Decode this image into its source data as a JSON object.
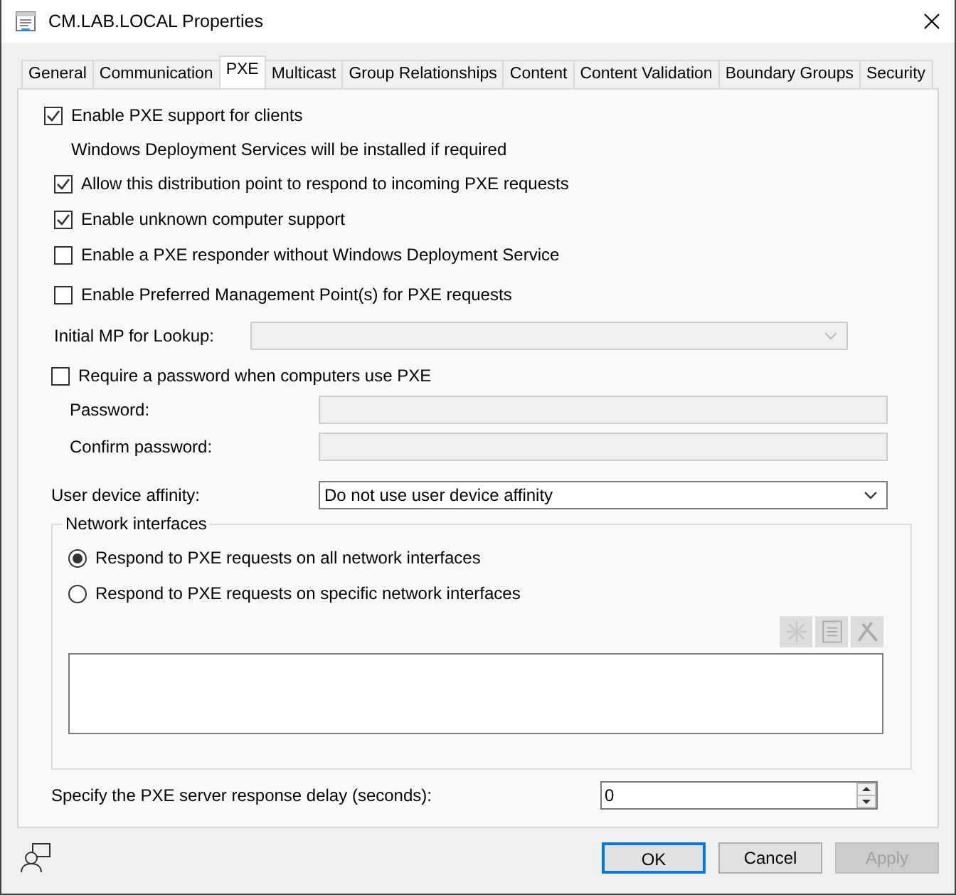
{
  "window": {
    "title": "CM.LAB.LOCAL Properties"
  },
  "tabs": [
    {
      "label": "General",
      "selected": false
    },
    {
      "label": "Communication",
      "selected": false
    },
    {
      "label": "PXE",
      "selected": true
    },
    {
      "label": "Multicast",
      "selected": false
    },
    {
      "label": "Group Relationships",
      "selected": false
    },
    {
      "label": "Content",
      "selected": false
    },
    {
      "label": "Content Validation",
      "selected": false
    },
    {
      "label": "Boundary Groups",
      "selected": false
    },
    {
      "label": "Security",
      "selected": false
    }
  ],
  "pxe": {
    "enable": {
      "label": "Enable PXE support for clients",
      "checked": true
    },
    "note": "Windows Deployment Services will be installed if required",
    "options": [
      {
        "label": "Allow this distribution point to respond to incoming PXE requests",
        "checked": true
      },
      {
        "label": "Enable unknown computer support",
        "checked": true
      },
      {
        "label": "Enable a PXE responder without Windows Deployment Service",
        "checked": false
      },
      {
        "label": "Enable Preferred Management Point(s) for PXE requests",
        "checked": false
      }
    ],
    "initial_mp": {
      "label": "Initial MP for Lookup:",
      "disabled": true
    },
    "require_password": {
      "label": "Require a password when computers use PXE",
      "checked": false
    },
    "password_fields": [
      {
        "label": "Password:",
        "disabled": true
      },
      {
        "label": "Confirm password:",
        "disabled": true
      }
    ],
    "affinity": {
      "label": "User device affinity:",
      "value": "Do not use user device affinity"
    },
    "network_interfaces": {
      "title": "Network interfaces",
      "choices": [
        {
          "label": "Respond to PXE requests on all network interfaces",
          "selected": true
        },
        {
          "label": "Respond to PXE requests on specific network interfaces",
          "selected": false
        }
      ]
    },
    "delay": {
      "label": "Specify the PXE server response delay (seconds):",
      "value": "0"
    }
  },
  "buttons": [
    {
      "label": "OK",
      "kind": "default",
      "disabled": false
    },
    {
      "label": "Cancel",
      "kind": "normal",
      "disabled": false
    },
    {
      "label": "Apply",
      "kind": "normal",
      "disabled": true
    }
  ]
}
